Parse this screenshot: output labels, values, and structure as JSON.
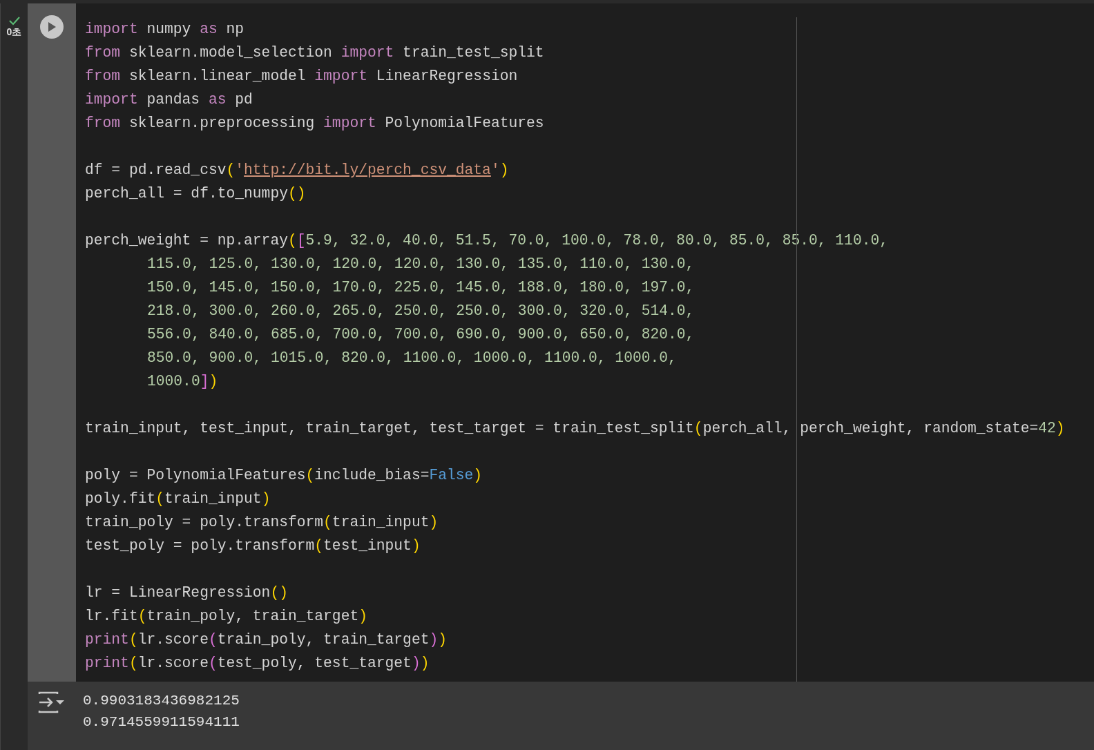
{
  "cell": {
    "status": {
      "done": true,
      "time": "0초"
    },
    "lines": [
      {
        "kind": "code",
        "tokens": [
          {
            "kind": "kw",
            "text": "import"
          },
          {
            "kind": "plain",
            "text": " numpy "
          },
          {
            "kind": "kw",
            "text": "as"
          },
          {
            "kind": "plain",
            "text": " np"
          }
        ]
      },
      {
        "kind": "code",
        "tokens": [
          {
            "kind": "kw",
            "text": "from"
          },
          {
            "kind": "plain",
            "text": " sklearn.model_selection "
          },
          {
            "kind": "kw",
            "text": "import"
          },
          {
            "kind": "plain",
            "text": " train_test_split"
          }
        ]
      },
      {
        "kind": "code",
        "tokens": [
          {
            "kind": "kw",
            "text": "from"
          },
          {
            "kind": "plain",
            "text": " sklearn.linear_model "
          },
          {
            "kind": "kw",
            "text": "import"
          },
          {
            "kind": "plain",
            "text": " LinearRegression"
          }
        ]
      },
      {
        "kind": "code",
        "tokens": [
          {
            "kind": "kw",
            "text": "import"
          },
          {
            "kind": "plain",
            "text": " pandas "
          },
          {
            "kind": "kw",
            "text": "as"
          },
          {
            "kind": "plain",
            "text": " pd"
          }
        ]
      },
      {
        "kind": "code",
        "tokens": [
          {
            "kind": "kw",
            "text": "from"
          },
          {
            "kind": "plain",
            "text": " sklearn.preprocessing "
          },
          {
            "kind": "kw",
            "text": "import"
          },
          {
            "kind": "plain",
            "text": " PolynomialFeatures"
          }
        ]
      },
      {
        "kind": "blank"
      },
      {
        "kind": "code",
        "tokens": [
          {
            "kind": "plain",
            "text": "df = pd.read_csv"
          },
          {
            "kind": "b1",
            "text": "("
          },
          {
            "kind": "str",
            "text": "'"
          },
          {
            "kind": "link",
            "text": "http://bit.ly/perch_csv_data"
          },
          {
            "kind": "str",
            "text": "'"
          },
          {
            "kind": "b1",
            "text": ")"
          }
        ]
      },
      {
        "kind": "code",
        "tokens": [
          {
            "kind": "plain",
            "text": "perch_all = df.to_numpy"
          },
          {
            "kind": "b1",
            "text": "()"
          }
        ]
      },
      {
        "kind": "blank"
      },
      {
        "kind": "code",
        "tokens": [
          {
            "kind": "plain",
            "text": "perch_weight = np.array"
          },
          {
            "kind": "b1",
            "text": "("
          },
          {
            "kind": "b2",
            "text": "["
          },
          {
            "kind": "num",
            "text": "5.9, 32.0, 40.0, 51.5, 70.0, 100.0, 78.0, 80.0, 85.0, 85.0, 110.0,"
          }
        ]
      },
      {
        "kind": "continuation",
        "tokens": [
          {
            "kind": "num",
            "text": "115.0, 125.0, 130.0, 120.0, 120.0, 130.0, 135.0, 110.0, 130.0,"
          }
        ]
      },
      {
        "kind": "continuation",
        "tokens": [
          {
            "kind": "num",
            "text": "150.0, 145.0, 150.0, 170.0, 225.0, 145.0, 188.0, 180.0, 197.0,"
          }
        ]
      },
      {
        "kind": "continuation",
        "tokens": [
          {
            "kind": "num",
            "text": "218.0, 300.0, 260.0, 265.0, 250.0, 250.0, 300.0, 320.0, 514.0,"
          }
        ]
      },
      {
        "kind": "continuation",
        "tokens": [
          {
            "kind": "num",
            "text": "556.0, 840.0, 685.0, 700.0, 700.0, 690.0, 900.0, 650.0, 820.0,"
          }
        ]
      },
      {
        "kind": "continuation",
        "tokens": [
          {
            "kind": "num",
            "text": "850.0, 900.0, 1015.0, 820.0, 1100.0, 1000.0, 1100.0, 1000.0,"
          }
        ]
      },
      {
        "kind": "continuation",
        "tokens": [
          {
            "kind": "num",
            "text": "1000.0"
          },
          {
            "kind": "b2",
            "text": "]"
          },
          {
            "kind": "b1",
            "text": ")"
          }
        ]
      },
      {
        "kind": "blank"
      },
      {
        "kind": "code",
        "tokens": [
          {
            "kind": "plain",
            "text": "train_input, test_input, train_target, test_target = train_test_split"
          },
          {
            "kind": "b1",
            "text": "("
          },
          {
            "kind": "plain",
            "text": "perch_all, perch_weight, random_state="
          },
          {
            "kind": "num",
            "text": "42"
          },
          {
            "kind": "b1",
            "text": ")"
          }
        ]
      },
      {
        "kind": "blank"
      },
      {
        "kind": "code",
        "tokens": [
          {
            "kind": "plain",
            "text": "poly = PolynomialFeatures"
          },
          {
            "kind": "b1",
            "text": "("
          },
          {
            "kind": "plain",
            "text": "include_bias="
          },
          {
            "kind": "const",
            "text": "False"
          },
          {
            "kind": "b1",
            "text": ")"
          }
        ]
      },
      {
        "kind": "code",
        "tokens": [
          {
            "kind": "plain",
            "text": "poly.fit"
          },
          {
            "kind": "b1",
            "text": "("
          },
          {
            "kind": "plain",
            "text": "train_input"
          },
          {
            "kind": "b1",
            "text": ")"
          }
        ]
      },
      {
        "kind": "code",
        "tokens": [
          {
            "kind": "plain",
            "text": "train_poly = poly.transform"
          },
          {
            "kind": "b1",
            "text": "("
          },
          {
            "kind": "plain",
            "text": "train_input"
          },
          {
            "kind": "b1",
            "text": ")"
          }
        ]
      },
      {
        "kind": "code",
        "tokens": [
          {
            "kind": "plain",
            "text": "test_poly = poly.transform"
          },
          {
            "kind": "b1",
            "text": "("
          },
          {
            "kind": "plain",
            "text": "test_input"
          },
          {
            "kind": "b1",
            "text": ")"
          }
        ]
      },
      {
        "kind": "blank"
      },
      {
        "kind": "code",
        "tokens": [
          {
            "kind": "plain",
            "text": "lr = LinearRegression"
          },
          {
            "kind": "b1",
            "text": "()"
          }
        ]
      },
      {
        "kind": "code",
        "tokens": [
          {
            "kind": "plain",
            "text": "lr.fit"
          },
          {
            "kind": "b1",
            "text": "("
          },
          {
            "kind": "plain",
            "text": "train_poly, train_target"
          },
          {
            "kind": "b1",
            "text": ")"
          }
        ]
      },
      {
        "kind": "code",
        "tokens": [
          {
            "kind": "kw",
            "text": "print"
          },
          {
            "kind": "b1",
            "text": "("
          },
          {
            "kind": "plain",
            "text": "lr.score"
          },
          {
            "kind": "b2",
            "text": "("
          },
          {
            "kind": "plain",
            "text": "train_poly, train_target"
          },
          {
            "kind": "b2",
            "text": ")"
          },
          {
            "kind": "b1",
            "text": ")"
          }
        ]
      },
      {
        "kind": "code",
        "tokens": [
          {
            "kind": "kw",
            "text": "print"
          },
          {
            "kind": "b1",
            "text": "("
          },
          {
            "kind": "plain",
            "text": "lr.score"
          },
          {
            "kind": "b2",
            "text": "("
          },
          {
            "kind": "plain",
            "text": "test_poly, test_target"
          },
          {
            "kind": "b2",
            "text": ")"
          },
          {
            "kind": "b1",
            "text": ")"
          }
        ]
      }
    ],
    "output": [
      "0.9903183436982125",
      "0.9714559911594111"
    ]
  }
}
